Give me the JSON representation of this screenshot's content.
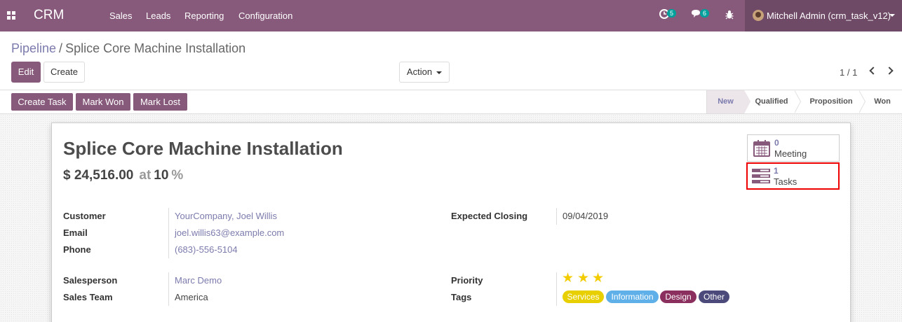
{
  "navbar": {
    "brand": "CRM",
    "menu": [
      "Sales",
      "Leads",
      "Reporting",
      "Configuration"
    ],
    "activity_count": "5",
    "message_count": "6",
    "user": "Mitchell Admin (crm_task_v12)"
  },
  "control_panel": {
    "breadcrumb_parent": "Pipeline",
    "breadcrumb_current": "Splice Core Machine Installation",
    "edit_label": "Edit",
    "create_label": "Create",
    "action_label": "Action",
    "pager": "1 / 1"
  },
  "statusbar": {
    "buttons": [
      "Create Task",
      "Mark Won",
      "Mark Lost"
    ],
    "stages": [
      "New",
      "Qualified",
      "Proposition",
      "Won"
    ],
    "active_stage": "New"
  },
  "record": {
    "title": "Splice Core Machine Installation",
    "revenue": "$ 24,516.00",
    "at_label": "at",
    "probability": "10",
    "percent_sign": "%",
    "smart_buttons": [
      {
        "count": "0",
        "label": "Meeting",
        "icon": "calendar-icon"
      },
      {
        "count": "1",
        "label": "Tasks",
        "icon": "tasks-icon"
      }
    ],
    "fields": {
      "customer_label": "Customer",
      "customer": "YourCompany, Joel Willis",
      "email_label": "Email",
      "email": "joel.willis63@example.com",
      "phone_label": "Phone",
      "phone": "(683)-556-5104",
      "expected_closing_label": "Expected Closing",
      "expected_closing": "09/04/2019",
      "salesperson_label": "Salesperson",
      "salesperson": "Marc Demo",
      "sales_team_label": "Sales Team",
      "sales_team": "America",
      "priority_label": "Priority",
      "priority_stars": 3,
      "tags_label": "Tags"
    },
    "tags": [
      {
        "name": "Services",
        "color": "#e8d000"
      },
      {
        "name": "Information",
        "color": "#5fb0e8"
      },
      {
        "name": "Design",
        "color": "#8a2f5e"
      },
      {
        "name": "Other",
        "color": "#4c4a7a"
      }
    ]
  },
  "colors": {
    "brand": "#875a7b",
    "link": "#7c7bad",
    "star": "#f3cc00",
    "highlight": "#e00000"
  }
}
